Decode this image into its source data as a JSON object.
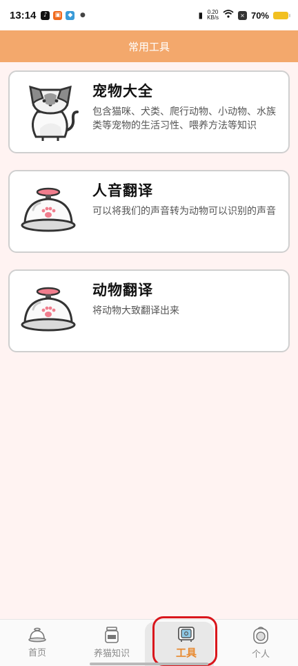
{
  "status_bar": {
    "time": "13:14",
    "net_speed_value": "0.20",
    "net_speed_unit": "KB/s",
    "battery": "70%"
  },
  "header": {
    "title": "常用工具"
  },
  "tools": [
    {
      "title": "宠物大全",
      "description": "包含猫咪、犬类、爬行动物、小动物、水族类等宠物的生活习性、喂养方法等知识",
      "icon": "cat-icon"
    },
    {
      "title": "人音翻译",
      "description": "可以将我们的声音转为动物可以识别的声音",
      "icon": "pet-bell-icon"
    },
    {
      "title": "动物翻译",
      "description": "将动物大致翻译出来",
      "icon": "pet-bell-icon"
    }
  ],
  "nav": {
    "items": [
      {
        "label": "首页",
        "icon": "bell-icon"
      },
      {
        "label": "养猫知识",
        "icon": "jar-icon"
      },
      {
        "label": "工具",
        "icon": "tv-icon",
        "active": true
      },
      {
        "label": "个人",
        "icon": "cat-bag-icon"
      }
    ]
  },
  "colors": {
    "header_bg": "#f3a86c",
    "active_nav": "#e8892e",
    "page_bg": "#fff3f2",
    "highlight": "#d9161c"
  }
}
